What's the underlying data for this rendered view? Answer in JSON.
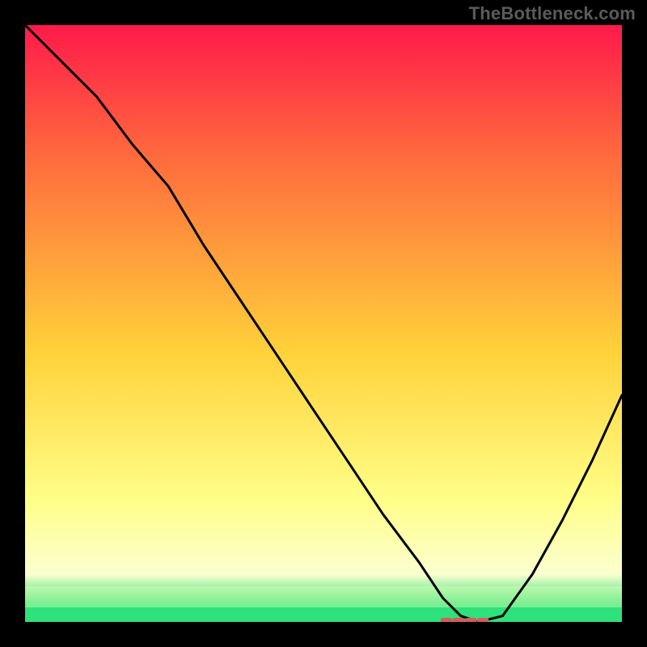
{
  "watermark": "TheBottleneck.com",
  "colors": {
    "frame": "#000000",
    "gradient_top": "#ff1a4a",
    "gradient_mid_upper": "#ff6a3d",
    "gradient_mid": "#ffd23a",
    "gradient_low": "#ffff8a",
    "gradient_pale": "#fbffd0",
    "gradient_green": "#2fe07a",
    "curve": "#000000",
    "marker": "#d85a5a"
  },
  "chart_data": {
    "type": "line",
    "title": "",
    "xlabel": "",
    "ylabel": "",
    "xlim": [
      0,
      100
    ],
    "ylim": [
      0,
      100
    ],
    "series": [
      {
        "name": "bottleneck-curve",
        "x": [
          0,
          6,
          12,
          18,
          24,
          30,
          36,
          42,
          48,
          54,
          60,
          66,
          70,
          73,
          76,
          80,
          85,
          90,
          95,
          100
        ],
        "y": [
          100,
          94,
          88,
          80,
          73,
          63,
          54,
          45,
          36,
          27,
          18,
          10,
          4,
          1,
          0,
          1,
          8,
          17,
          27,
          38
        ]
      }
    ],
    "annotations": [
      {
        "name": "match-marker",
        "x_start": 70,
        "x_end": 78,
        "y": 0
      }
    ]
  }
}
